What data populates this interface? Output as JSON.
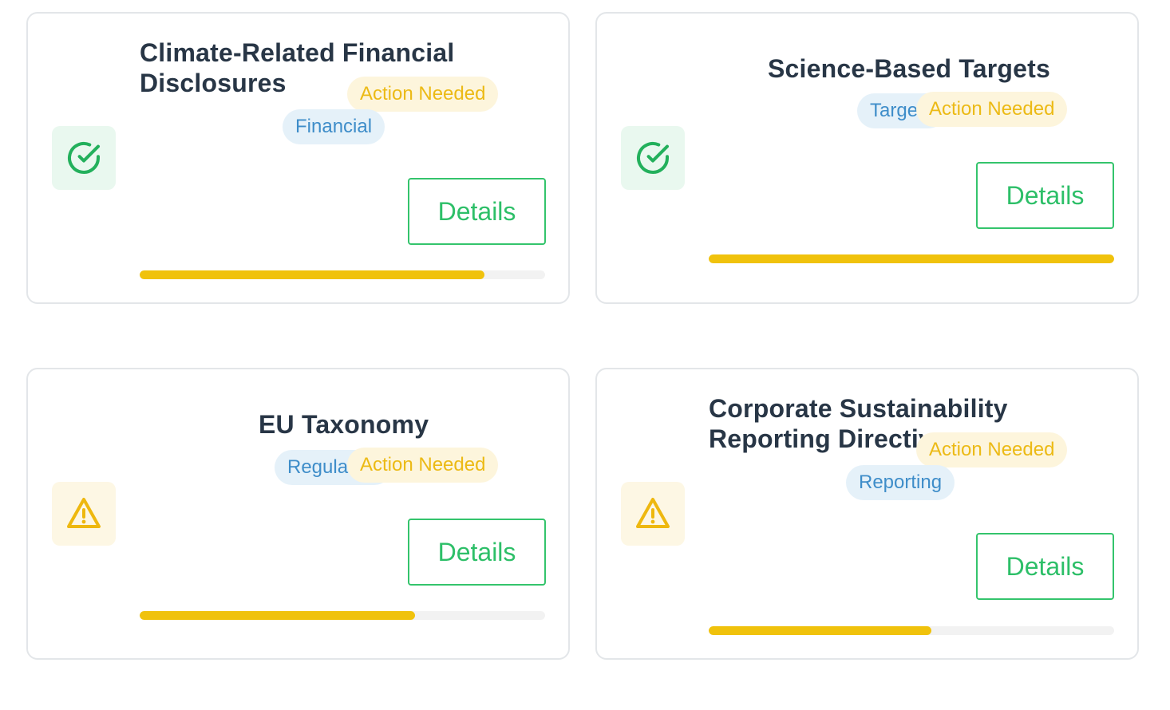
{
  "colors": {
    "accent_green": "#2dbf68",
    "warning_yellow": "#f0c20c",
    "category_blue": "#3e8dc9",
    "title_text": "#283646"
  },
  "cards": [
    {
      "title_line1": "Climate-Related Financial",
      "title_line2": "Disclosures",
      "status_icon": "check-circle-icon",
      "status_label": "Action Needed",
      "category": "Financial",
      "button_label": "Details",
      "progress": 0.85
    },
    {
      "title_line1": "Science-Based Targets",
      "status_icon": "check-circle-icon",
      "status_label": "Action Needed",
      "category": "Targets",
      "button_label": "Details",
      "progress": 1.0
    },
    {
      "title_line1": "EU Taxonomy",
      "status_icon": "warning-triangle-icon",
      "status_label": "Action Needed",
      "category": "Regulation",
      "button_label": "Details",
      "progress": 0.68
    },
    {
      "title_line1": "Corporate Sustainability",
      "title_line2": "Reporting Directive",
      "status_icon": "warning-triangle-icon",
      "status_label": "Action Needed",
      "category": "Reporting",
      "button_label": "Details",
      "progress": 0.55
    }
  ]
}
